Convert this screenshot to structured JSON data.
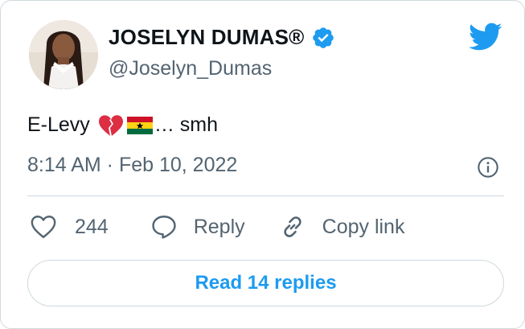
{
  "author": {
    "name": "JOSELYN DUMAS®",
    "handle": "@Joselyn_Dumas",
    "verified": true,
    "avatar": "profile-photo"
  },
  "tweet": {
    "text_before": "E-Levy",
    "emojis": [
      "broken-heart-emoji",
      "ghana-flag-emoji"
    ],
    "text_after": "… smh",
    "timestamp": "8:14 AM · Feb 10, 2022"
  },
  "actions": {
    "like_count": "244",
    "reply_label": "Reply",
    "copy_link_label": "Copy link"
  },
  "read_replies_label": "Read 14 replies",
  "icons": {
    "brand": "twitter-bird-icon",
    "verified": "verified-badge-icon",
    "info": "info-icon",
    "like": "heart-icon",
    "reply": "speech-bubble-icon",
    "copy": "link-icon"
  },
  "colors": {
    "accent": "#1d9bf0",
    "text_primary": "#0f1419",
    "text_secondary": "#536471",
    "border": "#cfd9de"
  }
}
